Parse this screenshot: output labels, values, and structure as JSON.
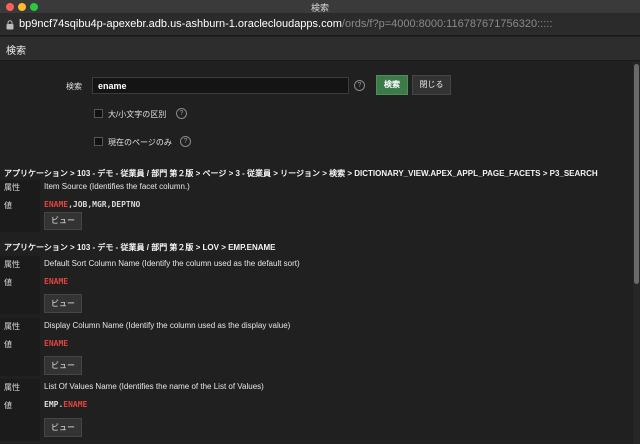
{
  "window": {
    "title": "検索"
  },
  "urlbar": {
    "host": "bp9ncf74sqibu4p-apexebr.adb.us-ashburn-1.oraclecloudapps.com",
    "path": "/ords/f?p=4000:8000:116787671756320:::::"
  },
  "dialog": {
    "title": "検索"
  },
  "search": {
    "label": "検索",
    "value": "ename",
    "search_button": "検索",
    "close_button": "閉じる",
    "case_label": "大/小文字の区別",
    "current_page_label": "現在のページのみ"
  },
  "results": [
    {
      "path": "アプリケーション > 103 - デモ - 従業員 / 部門 第２版 > ページ > 3 - 従業員 > リージョン > 検索 > DICTIONARY_VIEW.APEX_APPL_PAGE_FACETS > P3_SEARCH",
      "attr_key": "属性",
      "attr_value": "Item Source (Identifies the facet column.)",
      "value_key": "値",
      "value_match": "ENAME",
      "value_after": ",JOB,MGR,DEPTNO",
      "view_button": "ビュー"
    },
    {
      "path": "アプリケーション > 103 - デモ - 従業員 / 部門 第２版 > LOV > EMP.ENAME",
      "attr_key": "属性",
      "attr_value": "Default Sort Column Name (Identify the column used as the default sort)",
      "value_key": "値",
      "value_match": "ENAME",
      "view_button": "ビュー"
    },
    {
      "attr_key": "属性",
      "attr_value": "Display Column Name (Identify the column used as the display value)",
      "value_key": "値",
      "value_match": "ENAME",
      "view_button": "ビュー"
    },
    {
      "attr_key": "属性",
      "attr_value": "List Of Values Name (Identifies the name of the List of Values)",
      "value_key": "値",
      "value_before": "EMP.",
      "value_match": "ENAME",
      "view_button": "ビュー"
    }
  ],
  "icons": {
    "close": "close-icon",
    "minimize": "minimize-icon",
    "maximize": "maximize-icon",
    "lock": "lock-icon",
    "help": "help-icon"
  },
  "colors": {
    "accent_green": "#3c7a4a",
    "highlight_red": "#e0443e",
    "background": "#202020"
  }
}
